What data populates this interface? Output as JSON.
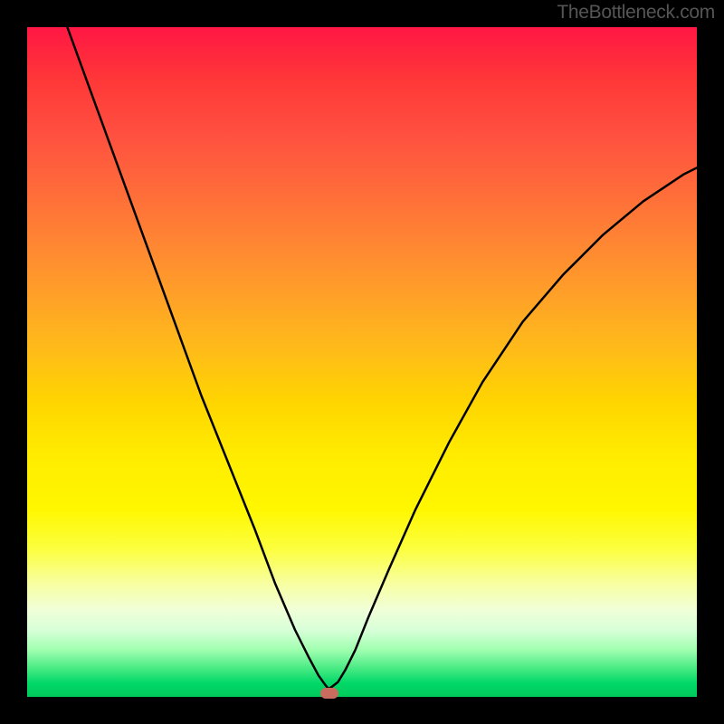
{
  "watermark": "TheBottleneck.com",
  "chart_data": {
    "type": "line",
    "title": "",
    "xlabel": "",
    "ylabel": "",
    "xlim": [
      0,
      100
    ],
    "ylim": [
      0,
      100
    ],
    "series": [
      {
        "name": "bottleneck-curve",
        "x": [
          6,
          10,
          14,
          18,
          22,
          26,
          30,
          34,
          37,
          40,
          42,
          43.5,
          44.5,
          45,
          45.5,
          46.4,
          47.5,
          49,
          51,
          54,
          58,
          63,
          68,
          74,
          80,
          86,
          92,
          98,
          100
        ],
        "y": [
          100,
          89,
          78,
          67,
          56,
          45,
          35,
          25,
          17,
          10,
          6,
          3.2,
          1.8,
          1.2,
          1.5,
          2.2,
          4,
          7,
          12,
          19,
          28,
          38,
          47,
          56,
          63,
          69,
          74,
          78,
          79
        ]
      }
    ],
    "marker": {
      "x": 45.2,
      "y": 0.6,
      "color": "#c96b5e"
    },
    "background_gradient": {
      "top": "#ff1744",
      "middle": "#ffec00",
      "bottom": "#00c85a"
    }
  }
}
